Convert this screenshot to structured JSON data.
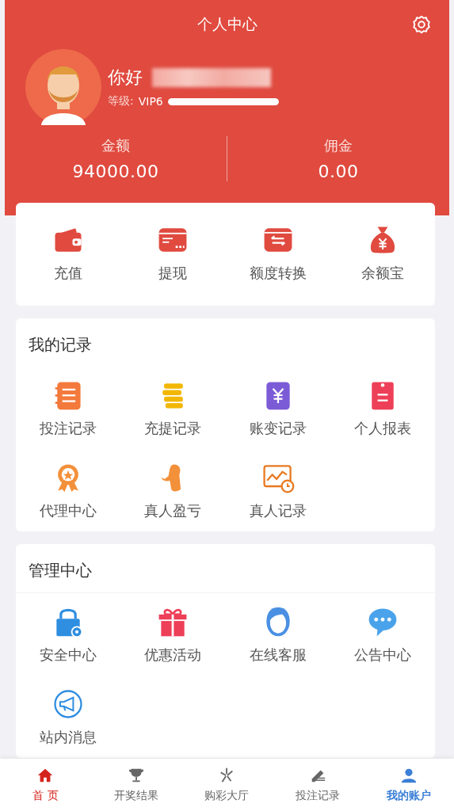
{
  "header": {
    "title": "个人中心",
    "greeting": "你好",
    "level_label": "等级:",
    "level_value": "VIP6",
    "level": 1
  },
  "balances": [
    {
      "label": "金额",
      "value": "94000.00"
    },
    {
      "label": "佣金",
      "value": "0.00"
    }
  ],
  "quick_actions": [
    {
      "label": "充值"
    },
    {
      "label": "提现"
    },
    {
      "label": "额度转换"
    },
    {
      "label": "余额宝"
    }
  ],
  "records": {
    "title": "我的记录",
    "items": [
      {
        "label": "投注记录"
      },
      {
        "label": "充提记录"
      },
      {
        "label": "账变记录"
      },
      {
        "label": "个人报表"
      },
      {
        "label": "代理中心"
      },
      {
        "label": "真人盈亏"
      },
      {
        "label": "真人记录"
      }
    ]
  },
  "management": {
    "title": "管理中心",
    "items": [
      {
        "label": "安全中心"
      },
      {
        "label": "优惠活动"
      },
      {
        "label": "在线客服"
      },
      {
        "label": "公告中心"
      },
      {
        "label": "站内消息"
      }
    ]
  },
  "tab_bar": [
    {
      "label": "首 页",
      "selected": false,
      "color": "#d4231c"
    },
    {
      "label": "开奖结果",
      "selected": false,
      "color": "#666666"
    },
    {
      "label": "购彩大厅",
      "selected": false,
      "color": "#666666"
    },
    {
      "label": "投注记录",
      "selected": false,
      "color": "#666666"
    },
    {
      "label": "我的账户",
      "selected": true,
      "color": "#3b7fd6"
    }
  ]
}
